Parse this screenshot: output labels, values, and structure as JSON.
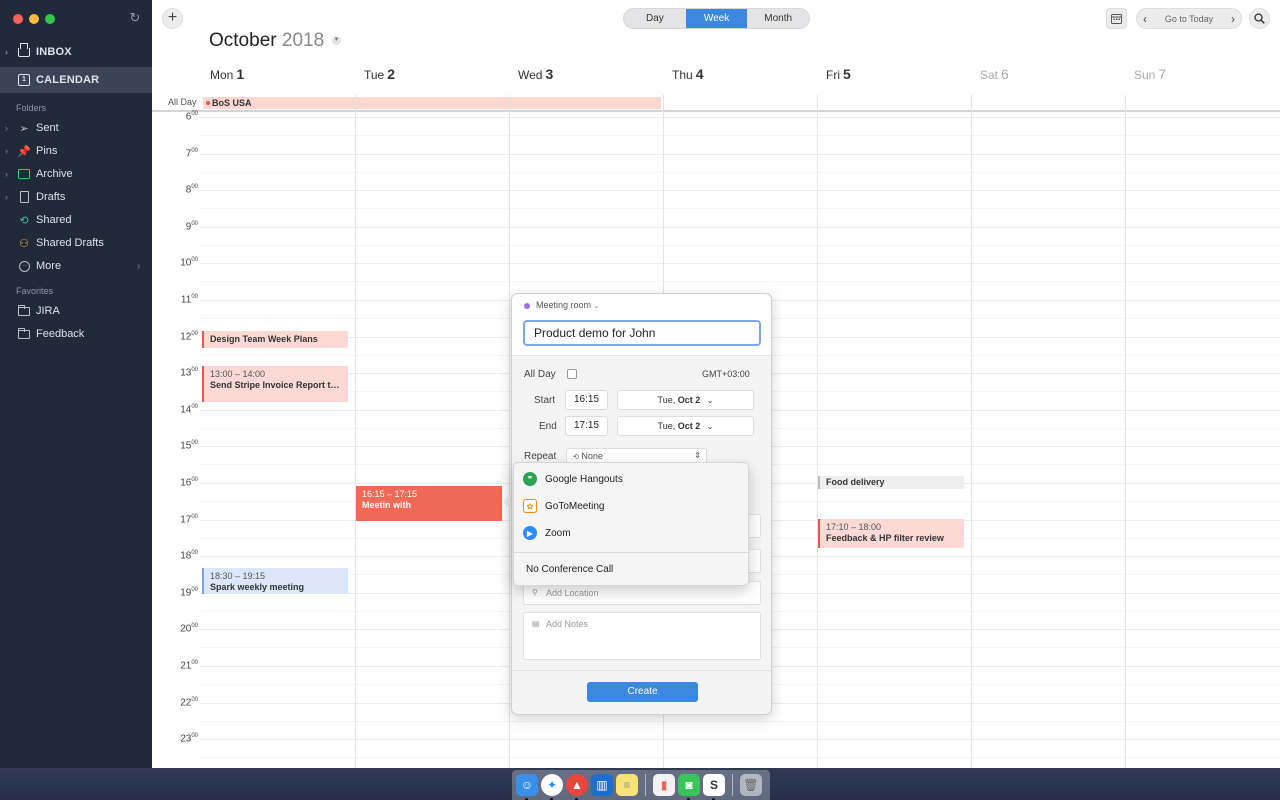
{
  "sidebar": {
    "inbox": "INBOX",
    "calendar": "CALENDAR",
    "calendar_icon_day": "1",
    "folders_header": "Folders",
    "folders": [
      "Sent",
      "Pins",
      "Archive",
      "Drafts",
      "Shared",
      "Shared Drafts",
      "More"
    ],
    "favorites_header": "Favorites",
    "favorites": [
      "JIRA",
      "Feedback"
    ],
    "colors": {
      "pins": "#e87b2e",
      "archive": "#3fc06a",
      "shared": "#3fc0a0",
      "shared_drafts": "#e8b02e"
    }
  },
  "toolbar": {
    "add": "+",
    "views": [
      "Day",
      "Week",
      "Month"
    ],
    "active_view": "Week",
    "prev": "‹",
    "next": "›",
    "go_to_today": "Go to Today"
  },
  "calendar": {
    "month": "October",
    "year": "2018",
    "days": [
      {
        "name": "Mon",
        "num": "1"
      },
      {
        "name": "Tue",
        "num": "2"
      },
      {
        "name": "Wed",
        "num": "3"
      },
      {
        "name": "Thu",
        "num": "4"
      },
      {
        "name": "Fri",
        "num": "5"
      },
      {
        "name": "Sat",
        "num": "6"
      },
      {
        "name": "Sun",
        "num": "7"
      }
    ],
    "all_day_label": "All Day",
    "all_day_event": "BoS USA",
    "hours": [
      "6",
      "7",
      "8",
      "9",
      "10",
      "11",
      "12",
      "13",
      "14",
      "15",
      "16",
      "17",
      "18",
      "19",
      "20",
      "21",
      "22",
      "23"
    ],
    "hour_suffix": "00",
    "events": {
      "design": {
        "title": "Design Team Week Plans"
      },
      "stripe": {
        "time": "13:00 – 14:00",
        "title": "Send Stripe Invoice Report to..."
      },
      "spark": {
        "time": "18:30 – 19:15",
        "title": "Spark weekly meeting"
      },
      "meetin": {
        "time": "16:15 – 17:15",
        "title": "Meetin with"
      },
      "food": {
        "title": "Food delivery"
      },
      "feedback": {
        "time": "17:10 – 18:00",
        "title": "Feedback & HP filter review"
      }
    }
  },
  "popover": {
    "calendar_name": "Meeting room",
    "title_value": "Product demo for John",
    "all_day_label": "All Day",
    "timezone": "GMT+03:00",
    "start_label": "Start",
    "start_time": "16:15",
    "start_day": "Tue,",
    "start_date": "Oct 2",
    "end_label": "End",
    "end_time": "17:15",
    "end_day": "Tue,",
    "end_date": "Oct 2",
    "repeat_label": "Repeat",
    "repeat_value": "None",
    "location_placeholder": "Add Location",
    "notes_placeholder": "Add Notes",
    "create": "Create"
  },
  "conference_menu": {
    "items": [
      "Google Hangouts",
      "GoToMeeting",
      "Zoom"
    ],
    "none": "No Conference Call",
    "colors": {
      "hangouts": "#2fa44f",
      "gotomeeting": "#f28b1f",
      "zoom": "#2d8cff"
    }
  },
  "colors": {
    "accent": "#3c87df",
    "sidebar_bg": "#212a38",
    "event_red": "#ef6a55"
  }
}
